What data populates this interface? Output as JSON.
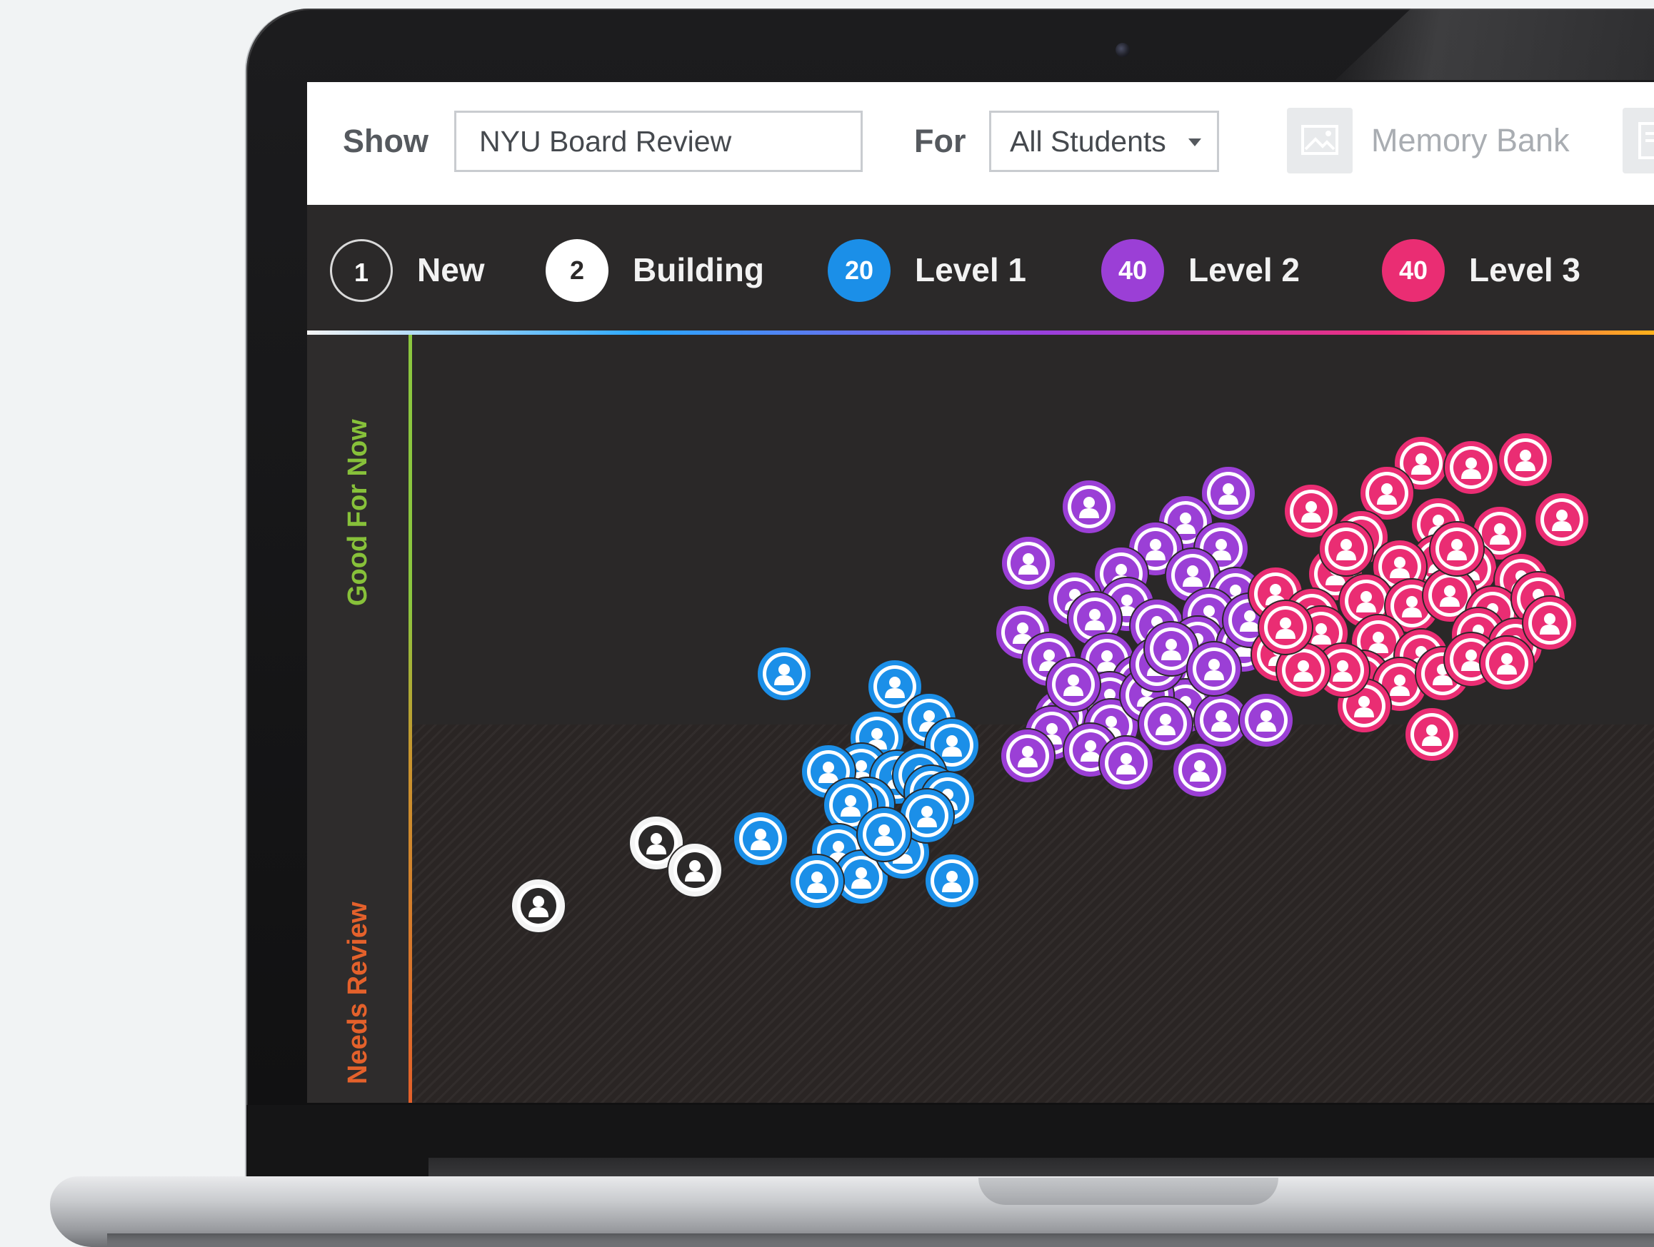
{
  "toolbar": {
    "show_label": "Show",
    "show_value": "NYU Board Review",
    "for_label": "For",
    "for_value": "All Students",
    "memory_bank_label": "Memory Bank",
    "memory_bank_icon": "image-icon",
    "second_icon": "document-icon"
  },
  "legend": [
    {
      "count": "1",
      "label": "New",
      "color": "#2b2929",
      "ring": "#d9d9d9",
      "text_color": "#ffffff"
    },
    {
      "count": "2",
      "label": "Building",
      "color": "#ffffff",
      "ring": "#ffffff",
      "text_color": "#2b2929"
    },
    {
      "count": "20",
      "label": "Level 1",
      "color": "#1b8fe8",
      "ring": "#1b8fe8",
      "text_color": "#ffffff"
    },
    {
      "count": "40",
      "label": "Level 2",
      "color": "#9b3fd6",
      "ring": "#9b3fd6",
      "text_color": "#ffffff"
    },
    {
      "count": "40",
      "label": "Level 3",
      "color": "#ea2d73",
      "ring": "#ea2d73",
      "text_color": "#ffffff"
    }
  ],
  "axis": {
    "good_label": "Good For Now",
    "review_label": "Needs Review",
    "good_color": "#87c13a",
    "review_color": "#e4612b"
  },
  "student_icon": "user-icon",
  "colors": {
    "new": "#2b2929",
    "building": "#ffffff",
    "level1": "#1b8fe8",
    "level2": "#9b3fd6",
    "level3": "#ea2d73"
  }
}
